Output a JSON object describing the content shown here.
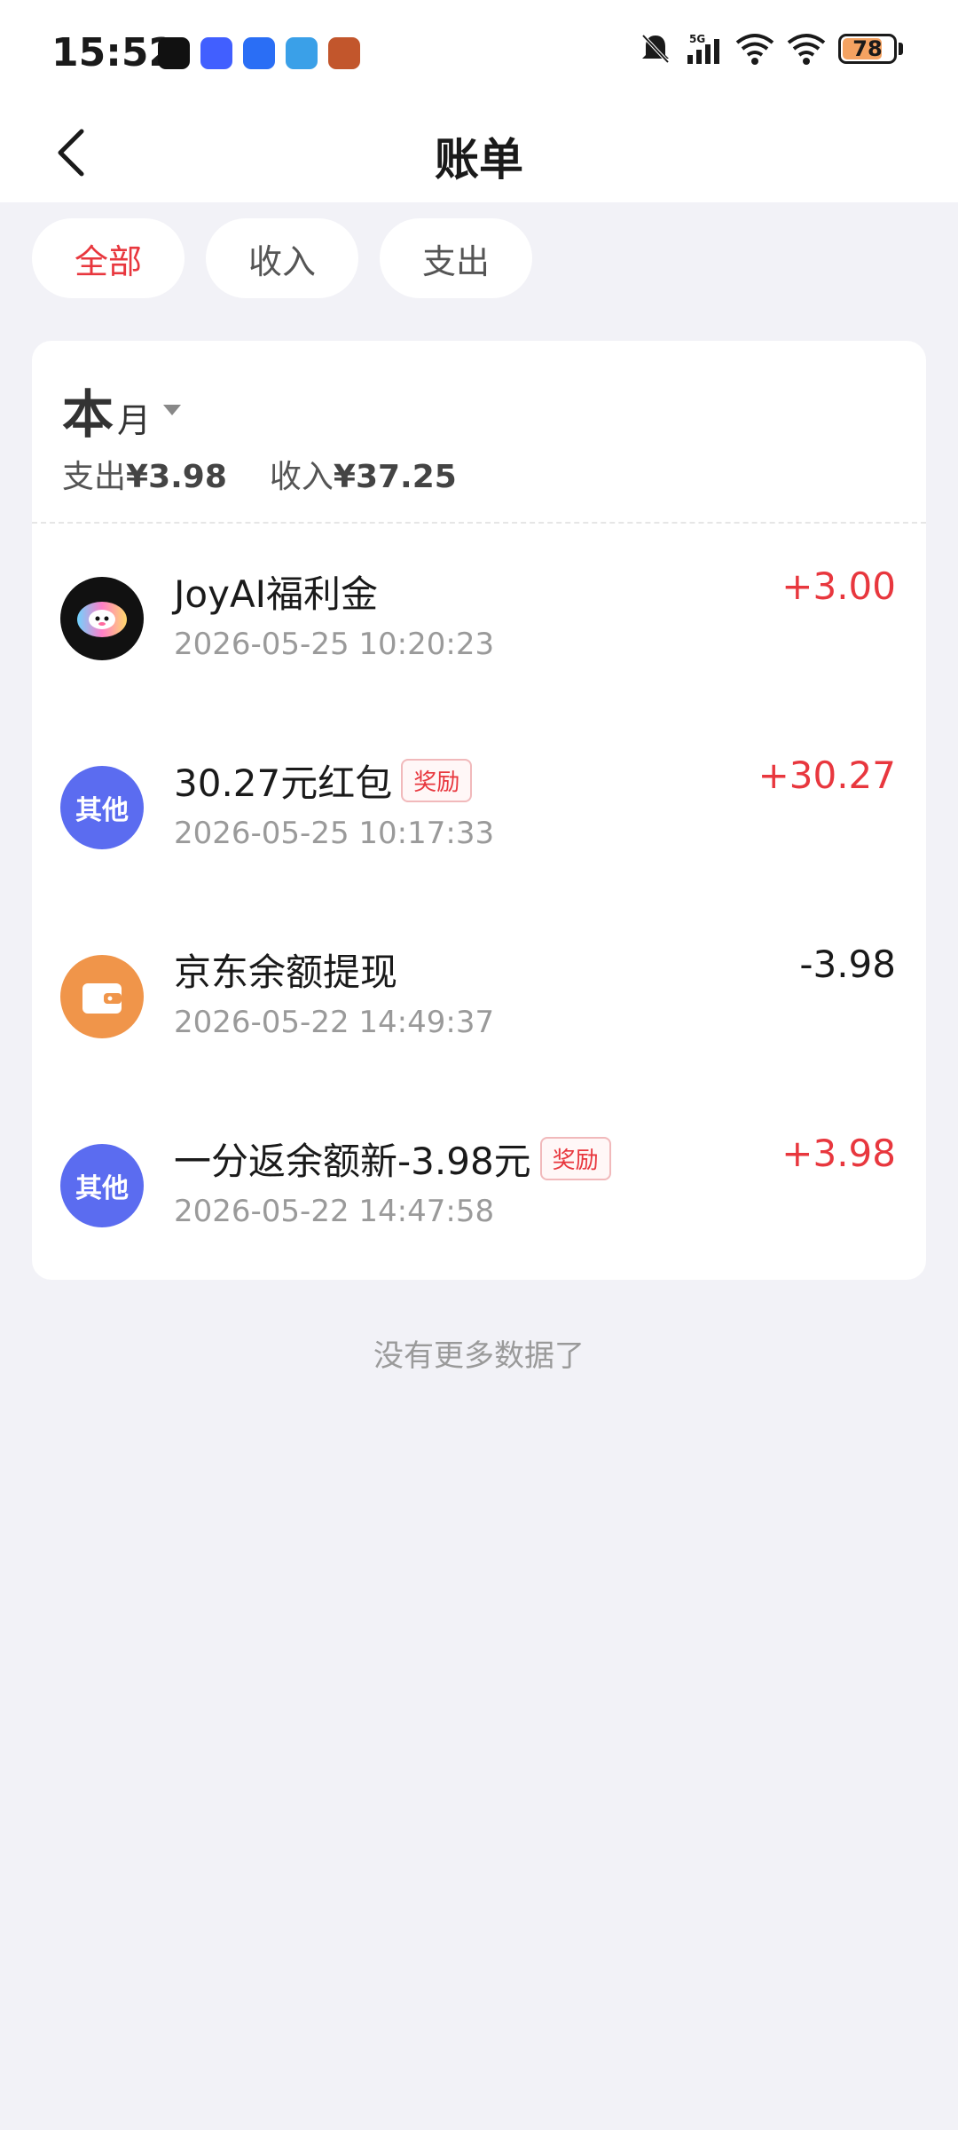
{
  "status_bar": {
    "time": "15:52",
    "battery": "78"
  },
  "nav": {
    "title": "账单"
  },
  "filters": [
    {
      "label": "全部",
      "active": true
    },
    {
      "label": "收入",
      "active": false
    },
    {
      "label": "支出",
      "active": false
    }
  ],
  "summary": {
    "month_big": "本",
    "month_small": "月",
    "expense_label": "支出",
    "expense_value": "¥3.98",
    "income_label": "收入",
    "income_value": "¥37.25"
  },
  "transactions": [
    {
      "avatar_text": "",
      "avatar_icon": "joyai-logo-icon",
      "title": "JoyAI福利金",
      "badge": "",
      "time": "2026-05-25 10:20:23",
      "amount": "+3.00",
      "sign": "pos"
    },
    {
      "avatar_text": "其他",
      "avatar_icon": "",
      "title": "30.27元红包",
      "badge": "奖励",
      "time": "2026-05-25 10:17:33",
      "amount": "+30.27",
      "sign": "pos"
    },
    {
      "avatar_text": "",
      "avatar_icon": "wallet-icon",
      "title": "京东余额提现",
      "badge": "",
      "time": "2026-05-22 14:49:37",
      "amount": "-3.98",
      "sign": "neg"
    },
    {
      "avatar_text": "其他",
      "avatar_icon": "",
      "title": "一分返余额新-3.98元",
      "badge": "奖励",
      "time": "2026-05-22 14:47:58",
      "amount": "+3.98",
      "sign": "pos"
    }
  ],
  "footer": {
    "no_more": "没有更多数据了"
  },
  "colors": {
    "accent_red": "#e8373e",
    "avatar_blue": "#5b6cf0",
    "avatar_orange": "#f0954a",
    "background": "#f2f2f7"
  }
}
